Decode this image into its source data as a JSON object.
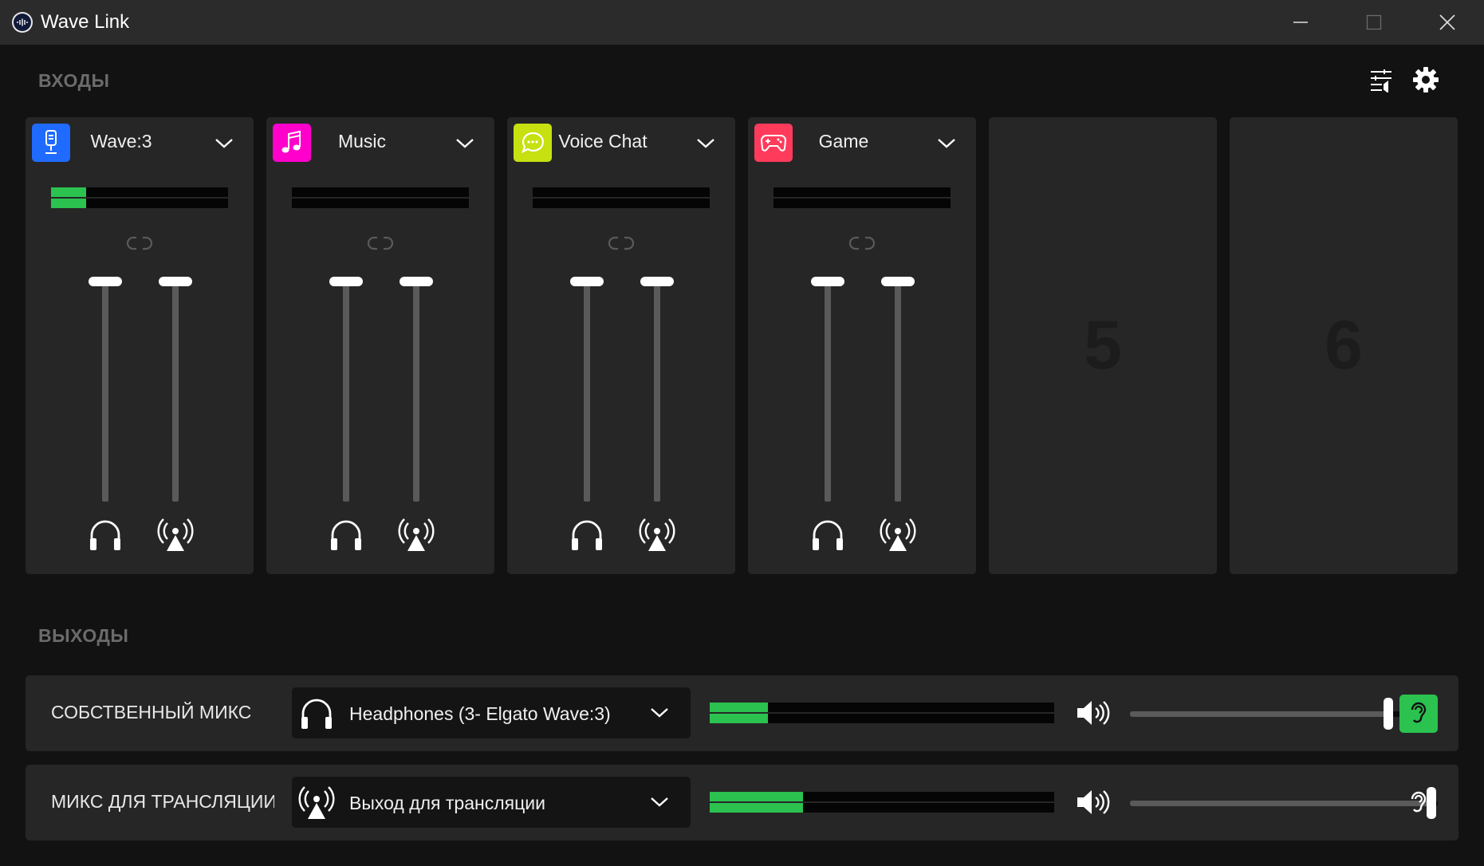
{
  "app": {
    "title": "Wave Link"
  },
  "sections": {
    "inputs": "ВХОДЫ",
    "outputs": "ВЫХОДЫ"
  },
  "colors": {
    "meter_green": "#2bc250",
    "wave_blue": "#1f6bff",
    "music_magenta": "#ff00cc",
    "voice_lime": "#c6e010",
    "game_red": "#ff3b5c"
  },
  "channels": [
    {
      "name": "Wave:3",
      "icon": "microphone-icon",
      "color": "#1f6bff",
      "meter_level": 0.2,
      "monitor_fader": 1.0,
      "stream_fader": 1.0
    },
    {
      "name": "Music",
      "icon": "music-note-icon",
      "color": "#ff00cc",
      "meter_level": 0.0,
      "monitor_fader": 1.0,
      "stream_fader": 1.0
    },
    {
      "name": "Voice Chat",
      "icon": "chat-bubble-icon",
      "color": "#c6e010",
      "meter_level": 0.0,
      "monitor_fader": 1.0,
      "stream_fader": 1.0
    },
    {
      "name": "Game",
      "icon": "gamepad-icon",
      "color": "#ff3b5c",
      "meter_level": 0.0,
      "monitor_fader": 1.0,
      "stream_fader": 1.0
    }
  ],
  "empty_slots": [
    "5",
    "6"
  ],
  "outputs": [
    {
      "name": "СОБСТВЕННЫЙ МИКС",
      "device": "Headphones (3- Elgato Wave:3)",
      "device_icon": "headphones-icon",
      "meter_level": 0.17,
      "volume": 0.84,
      "listen_active": true
    },
    {
      "name": "МИКС ДЛЯ ТРАНСЛЯЦИИ",
      "device": "Выход для трансляции",
      "device_icon": "broadcast-icon",
      "meter_level": 0.27,
      "volume": 0.98,
      "listen_active": false
    }
  ]
}
